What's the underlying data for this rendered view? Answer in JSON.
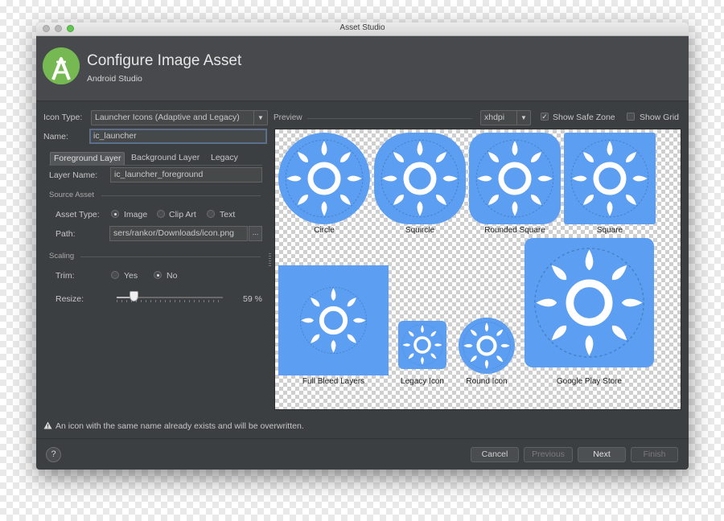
{
  "window": {
    "title": "Asset Studio"
  },
  "header": {
    "title": "Configure Image Asset",
    "subtitle": "Android Studio"
  },
  "form": {
    "icon_type_label": "Icon Type:",
    "icon_type_value": "Launcher Icons (Adaptive and Legacy)",
    "name_label": "Name:",
    "name_value": "ic_launcher",
    "tabs": [
      {
        "label": "Foreground Layer",
        "active": true
      },
      {
        "label": "Background Layer",
        "active": false
      },
      {
        "label": "Legacy",
        "active": false
      }
    ],
    "layer_name_label": "Layer Name:",
    "layer_name_value": "ic_launcher_foreground",
    "source_asset_section": "Source Asset",
    "asset_type_label": "Asset Type:",
    "asset_type_options": [
      {
        "label": "Image",
        "selected": true
      },
      {
        "label": "Clip Art",
        "selected": false
      },
      {
        "label": "Text",
        "selected": false
      }
    ],
    "path_label": "Path:",
    "path_value": "sers/rankor/Downloads/icon.png",
    "browse_button": "...",
    "scaling_section": "Scaling",
    "trim_label": "Trim:",
    "trim_options": [
      {
        "label": "Yes",
        "selected": false
      },
      {
        "label": "No",
        "selected": true
      }
    ],
    "resize_label": "Resize:",
    "resize_value": "59 %",
    "resize_fraction": 0.16
  },
  "preview": {
    "label": "Preview",
    "density_value": "xhdpi",
    "show_safe_zone_label": "Show Safe Zone",
    "show_safe_zone_checked": true,
    "show_grid_label": "Show Grid",
    "show_grid_checked": false,
    "icons": [
      {
        "label": "Circle",
        "shape": "circle"
      },
      {
        "label": "Squircle",
        "shape": "squircle"
      },
      {
        "label": "Rounded Square",
        "shape": "rounded-square"
      },
      {
        "label": "Square",
        "shape": "square"
      },
      {
        "label": "Full Bleed Layers",
        "shape": "full-bleed"
      },
      {
        "label": "Legacy Icon",
        "shape": "legacy"
      },
      {
        "label": "Round Icon",
        "shape": "round"
      },
      {
        "label": "Google Play Store",
        "shape": "play-store"
      }
    ],
    "icon_color": "#5c9ef1"
  },
  "warning": {
    "icon": "warning-triangle-icon",
    "text": "An icon with the same name already exists and will be overwritten."
  },
  "footer": {
    "help_label": "?",
    "buttons": [
      {
        "label": "Cancel",
        "enabled": true
      },
      {
        "label": "Previous",
        "enabled": false
      },
      {
        "label": "Next",
        "enabled": true
      },
      {
        "label": "Finish",
        "enabled": false
      }
    ]
  }
}
